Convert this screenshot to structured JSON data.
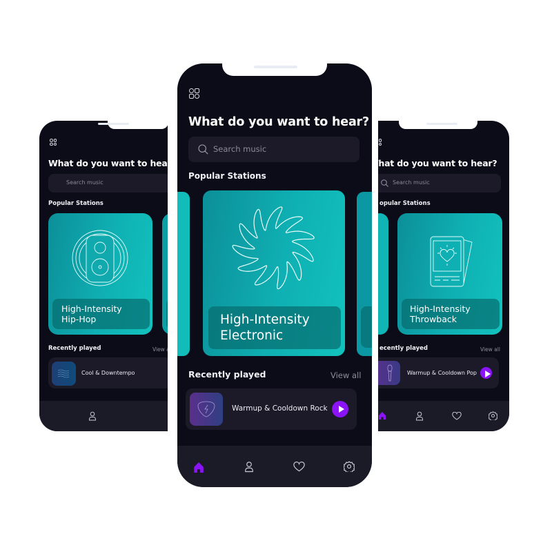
{
  "app": {
    "heading": "What do you want to hear?",
    "search_placeholder": "Search music",
    "popular_title": "Popular Stations",
    "recent_title": "Recently played",
    "view_all": "View all",
    "accent_color": "#8a14f5",
    "card_color": "#0fb0b3"
  },
  "phones": {
    "left": {
      "station": {
        "line1": "High-Intensity",
        "line2": "Hip-Hop",
        "icon": "speaker-icon"
      },
      "recent": {
        "title": "Cool & Downtempo",
        "icon": "waves-icon"
      },
      "view_all_partial": "View a"
    },
    "center": {
      "station": {
        "line1": "High-Intensity",
        "line2": "Electronic",
        "icon": "starburst-wave-icon"
      },
      "recent": {
        "title": "Warmup & Cooldown Rock",
        "icon": "guitar-pick-lightning-icon"
      }
    },
    "right": {
      "heading_partial": "/hat do you want to hear?",
      "popular_partial": "opular Stations",
      "recent_partial": "ecently played",
      "station": {
        "line1": "High-Intensity",
        "line2": "Throwback",
        "icon": "photo-heart-icon"
      },
      "recent": {
        "title": "Warmup & Cooldown Pop",
        "icon": "microphone-icon"
      }
    }
  },
  "nav": {
    "items": [
      "home",
      "profile",
      "favorites",
      "settings"
    ],
    "active": "home"
  }
}
